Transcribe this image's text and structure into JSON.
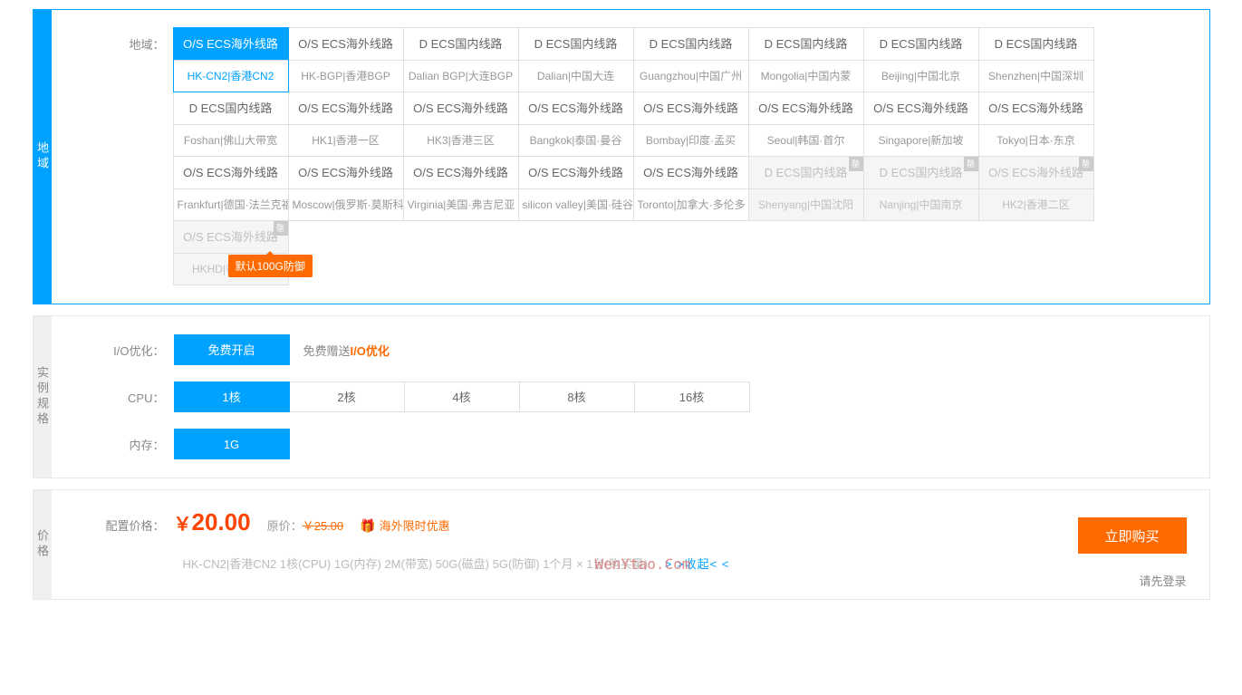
{
  "sections": {
    "region": "地域",
    "spec": "实例规格",
    "price": "价格"
  },
  "labels": {
    "region": "地域：",
    "io": "I/O优化：",
    "cpu": "CPU：",
    "memory": "内存：",
    "price": "配置价格："
  },
  "regions": [
    {
      "line1": "O/S ECS海外线路",
      "line2": "HK-CN2|香港CN2",
      "selected": true
    },
    {
      "line1": "O/S ECS海外线路",
      "line2": "HK-BGP|香港BGP"
    },
    {
      "line1": "D ECS国内线路",
      "line2": "Dalian BGP|大连BGP"
    },
    {
      "line1": "D ECS国内线路",
      "line2": "Dalian|中国大连"
    },
    {
      "line1": "D ECS国内线路",
      "line2": "Guangzhou|中国广州"
    },
    {
      "line1": "D ECS国内线路",
      "line2": "Mongolia|中国内蒙"
    },
    {
      "line1": "D ECS国内线路",
      "line2": "Beijing|中国北京"
    },
    {
      "line1": "D ECS国内线路",
      "line2": "Shenzhen|中国深圳"
    },
    {
      "line1": "D ECS国内线路",
      "line2": "Foshan|佛山大带宽"
    },
    {
      "line1": "O/S ECS海外线路",
      "line2": "HK1|香港一区"
    },
    {
      "line1": "O/S ECS海外线路",
      "line2": "HK3|香港三区"
    },
    {
      "line1": "O/S ECS海外线路",
      "line2": "Bangkok|泰国·曼谷"
    },
    {
      "line1": "O/S ECS海外线路",
      "line2": "Bombay|印度·孟买"
    },
    {
      "line1": "O/S ECS海外线路",
      "line2": "Seoul|韩国·首尔"
    },
    {
      "line1": "O/S ECS海外线路",
      "line2": "Singapore|新加坡"
    },
    {
      "line1": "O/S ECS海外线路",
      "line2": "Tokyo|日本·东京"
    },
    {
      "line1": "O/S ECS海外线路",
      "line2": "Frankfurt|德国·法兰克福"
    },
    {
      "line1": "O/S ECS海外线路",
      "line2": "Moscow|俄罗斯·莫斯科"
    },
    {
      "line1": "O/S ECS海外线路",
      "line2": "Virginia|美国·弗吉尼亚"
    },
    {
      "line1": "O/S ECS海外线路",
      "line2": "silicon valley|美国·硅谷"
    },
    {
      "line1": "O/S ECS海外线路",
      "line2": "Toronto|加拿大·多伦多"
    },
    {
      "line1": "D ECS国内线路",
      "line2": "Shenyang|中国沈阳",
      "disabled": true,
      "badge": "罄"
    },
    {
      "line1": "D ECS国内线路",
      "line2": "Nanjing|中国南京",
      "disabled": true,
      "badge": "罄"
    },
    {
      "line1": "O/S ECS海外线路",
      "line2": "HK2|香港二区",
      "disabled": true,
      "badge": "罄"
    },
    {
      "line1": "O/S ECS海外线路",
      "line2": "HKHD|香港高防",
      "disabled": true,
      "badge": "罄"
    }
  ],
  "tooltip": "默认100G防御",
  "io": {
    "button": "免费开启",
    "note_prefix": "免费赠送",
    "note_highlight": "I/O优化"
  },
  "cpu_options": [
    "1核",
    "2核",
    "4核",
    "8核",
    "16核"
  ],
  "cpu_selected": 0,
  "memory_options": [
    "1G"
  ],
  "memory_selected": 0,
  "price": {
    "currency": "￥",
    "amount": "20.00",
    "orig_label": "原价：",
    "orig_currency": "￥",
    "orig_amount": "25.00",
    "promo_icon": "🎁",
    "promo_text": "海外限时优惠"
  },
  "summary": "HK-CN2|香港CN2  1核(CPU)  1G(内存)  2M(带宽)  50G(磁盘)  5G(防御)  1个月 × 1台(购买量)",
  "collapse": "> >收起< <",
  "buy_button": "立即购买",
  "login_hint": "请先登录",
  "watermark": "WenYtao.Com"
}
